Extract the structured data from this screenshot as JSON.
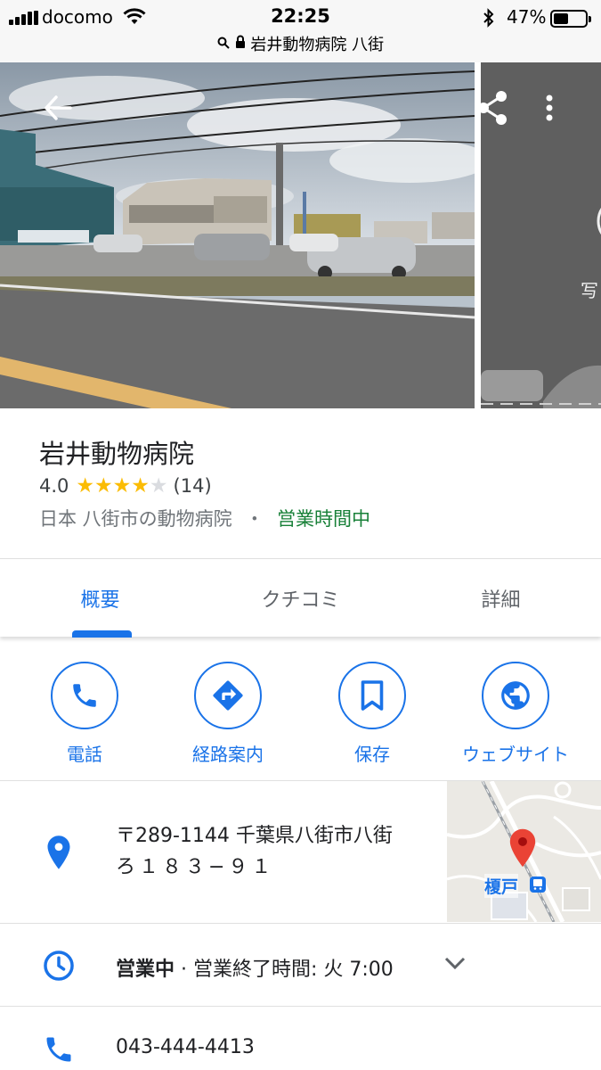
{
  "status_bar": {
    "carrier": "docomo",
    "time": "22:25",
    "battery_percent": "47%",
    "battery_level": 0.47
  },
  "url_bar": {
    "title": "岩井動物病院 八街"
  },
  "photos": {
    "second_label": "写"
  },
  "place": {
    "name": "岩井動物病院",
    "rating": "4.0",
    "rating_value": 4.0,
    "review_count": "(14)",
    "category": "日本 八街市の動物病院",
    "separator": "・",
    "open_status": "営業時間中"
  },
  "tabs": [
    {
      "label": "概要",
      "active": true
    },
    {
      "label": "クチコミ",
      "active": false
    },
    {
      "label": "詳細",
      "active": false
    }
  ],
  "actions": [
    {
      "label": "電話",
      "icon": "phone-icon"
    },
    {
      "label": "経路案内",
      "icon": "directions-icon"
    },
    {
      "label": "保存",
      "icon": "bookmark-icon"
    },
    {
      "label": "ウェブサイト",
      "icon": "globe-icon"
    }
  ],
  "address": {
    "line1": "〒289-1144 千葉県八街市八街",
    "line2": "ろ１８３−９１",
    "map_label": "榎戸"
  },
  "hours": {
    "status": "営業中",
    "detail": " · 営業終了時間: 火 7:00"
  },
  "phone": {
    "number": "043-444-4413"
  },
  "colors": {
    "accent": "#1a73e8",
    "open_green": "#188038",
    "star": "#fbbc04",
    "map_pin": "#ea4335"
  }
}
